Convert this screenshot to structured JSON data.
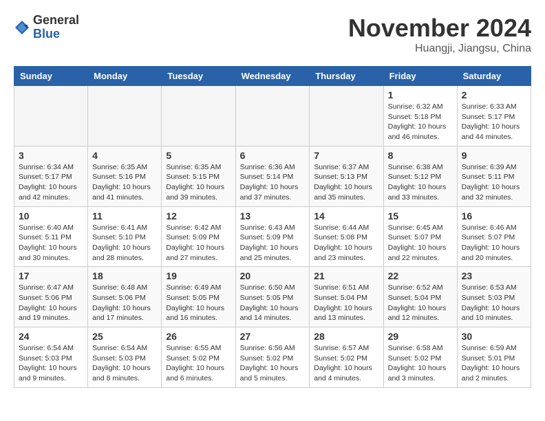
{
  "header": {
    "logo_general": "General",
    "logo_blue": "Blue",
    "title": "November 2024",
    "location": "Huangji, Jiangsu, China"
  },
  "weekdays": [
    "Sunday",
    "Monday",
    "Tuesday",
    "Wednesday",
    "Thursday",
    "Friday",
    "Saturday"
  ],
  "weeks": [
    [
      {
        "day": "",
        "info": ""
      },
      {
        "day": "",
        "info": ""
      },
      {
        "day": "",
        "info": ""
      },
      {
        "day": "",
        "info": ""
      },
      {
        "day": "",
        "info": ""
      },
      {
        "day": "1",
        "info": "Sunrise: 6:32 AM\nSunset: 5:18 PM\nDaylight: 10 hours\nand 46 minutes."
      },
      {
        "day": "2",
        "info": "Sunrise: 6:33 AM\nSunset: 5:17 PM\nDaylight: 10 hours\nand 44 minutes."
      }
    ],
    [
      {
        "day": "3",
        "info": "Sunrise: 6:34 AM\nSunset: 5:17 PM\nDaylight: 10 hours\nand 42 minutes."
      },
      {
        "day": "4",
        "info": "Sunrise: 6:35 AM\nSunset: 5:16 PM\nDaylight: 10 hours\nand 41 minutes."
      },
      {
        "day": "5",
        "info": "Sunrise: 6:35 AM\nSunset: 5:15 PM\nDaylight: 10 hours\nand 39 minutes."
      },
      {
        "day": "6",
        "info": "Sunrise: 6:36 AM\nSunset: 5:14 PM\nDaylight: 10 hours\nand 37 minutes."
      },
      {
        "day": "7",
        "info": "Sunrise: 6:37 AM\nSunset: 5:13 PM\nDaylight: 10 hours\nand 35 minutes."
      },
      {
        "day": "8",
        "info": "Sunrise: 6:38 AM\nSunset: 5:12 PM\nDaylight: 10 hours\nand 33 minutes."
      },
      {
        "day": "9",
        "info": "Sunrise: 6:39 AM\nSunset: 5:11 PM\nDaylight: 10 hours\nand 32 minutes."
      }
    ],
    [
      {
        "day": "10",
        "info": "Sunrise: 6:40 AM\nSunset: 5:11 PM\nDaylight: 10 hours\nand 30 minutes."
      },
      {
        "day": "11",
        "info": "Sunrise: 6:41 AM\nSunset: 5:10 PM\nDaylight: 10 hours\nand 28 minutes."
      },
      {
        "day": "12",
        "info": "Sunrise: 6:42 AM\nSunset: 5:09 PM\nDaylight: 10 hours\nand 27 minutes."
      },
      {
        "day": "13",
        "info": "Sunrise: 6:43 AM\nSunset: 5:09 PM\nDaylight: 10 hours\nand 25 minutes."
      },
      {
        "day": "14",
        "info": "Sunrise: 6:44 AM\nSunset: 5:08 PM\nDaylight: 10 hours\nand 23 minutes."
      },
      {
        "day": "15",
        "info": "Sunrise: 6:45 AM\nSunset: 5:07 PM\nDaylight: 10 hours\nand 22 minutes."
      },
      {
        "day": "16",
        "info": "Sunrise: 6:46 AM\nSunset: 5:07 PM\nDaylight: 10 hours\nand 20 minutes."
      }
    ],
    [
      {
        "day": "17",
        "info": "Sunrise: 6:47 AM\nSunset: 5:06 PM\nDaylight: 10 hours\nand 19 minutes."
      },
      {
        "day": "18",
        "info": "Sunrise: 6:48 AM\nSunset: 5:06 PM\nDaylight: 10 hours\nand 17 minutes."
      },
      {
        "day": "19",
        "info": "Sunrise: 6:49 AM\nSunset: 5:05 PM\nDaylight: 10 hours\nand 16 minutes."
      },
      {
        "day": "20",
        "info": "Sunrise: 6:50 AM\nSunset: 5:05 PM\nDaylight: 10 hours\nand 14 minutes."
      },
      {
        "day": "21",
        "info": "Sunrise: 6:51 AM\nSunset: 5:04 PM\nDaylight: 10 hours\nand 13 minutes."
      },
      {
        "day": "22",
        "info": "Sunrise: 6:52 AM\nSunset: 5:04 PM\nDaylight: 10 hours\nand 12 minutes."
      },
      {
        "day": "23",
        "info": "Sunrise: 6:53 AM\nSunset: 5:03 PM\nDaylight: 10 hours\nand 10 minutes."
      }
    ],
    [
      {
        "day": "24",
        "info": "Sunrise: 6:54 AM\nSunset: 5:03 PM\nDaylight: 10 hours\nand 9 minutes."
      },
      {
        "day": "25",
        "info": "Sunrise: 6:54 AM\nSunset: 5:03 PM\nDaylight: 10 hours\nand 8 minutes."
      },
      {
        "day": "26",
        "info": "Sunrise: 6:55 AM\nSunset: 5:02 PM\nDaylight: 10 hours\nand 6 minutes."
      },
      {
        "day": "27",
        "info": "Sunrise: 6:56 AM\nSunset: 5:02 PM\nDaylight: 10 hours\nand 5 minutes."
      },
      {
        "day": "28",
        "info": "Sunrise: 6:57 AM\nSunset: 5:02 PM\nDaylight: 10 hours\nand 4 minutes."
      },
      {
        "day": "29",
        "info": "Sunrise: 6:58 AM\nSunset: 5:02 PM\nDaylight: 10 hours\nand 3 minutes."
      },
      {
        "day": "30",
        "info": "Sunrise: 6:59 AM\nSunset: 5:01 PM\nDaylight: 10 hours\nand 2 minutes."
      }
    ]
  ]
}
